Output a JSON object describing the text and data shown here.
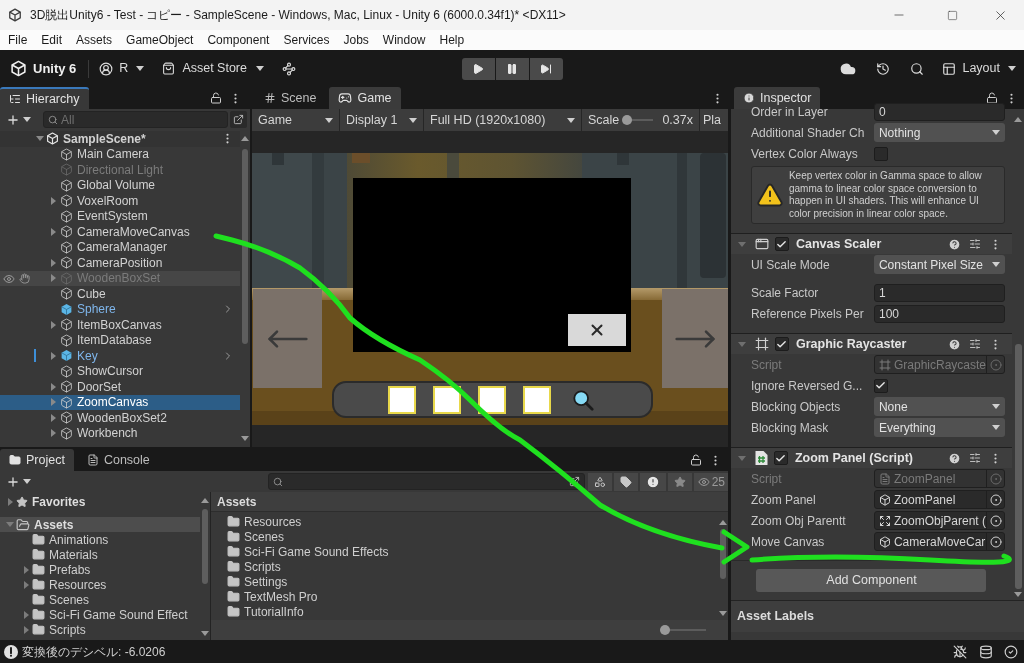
{
  "window": {
    "title": "3D脱出Unity6 - Test - コピー - SampleScene - Windows, Mac, Linux - Unity 6 (6000.0.34f1)* <DX11>"
  },
  "menu": [
    "File",
    "Edit",
    "Assets",
    "GameObject",
    "Component",
    "Services",
    "Jobs",
    "Window",
    "Help"
  ],
  "toolbar": {
    "product": "Unity 6",
    "account": "R",
    "asset_store": "Asset Store",
    "playback": [
      {
        "kind": "play"
      },
      {
        "kind": "pause"
      },
      {
        "kind": "step"
      }
    ],
    "layout": "Layout"
  },
  "hierarchy": {
    "tab": {
      "label": "Hierarchy",
      "selected": true,
      "focused": true
    },
    "search": {
      "placeholder": "All"
    },
    "tree": [
      {
        "name": "SampleScene*",
        "kind": "scene",
        "has_children": true,
        "expanded": true,
        "disabled": false,
        "selected": false,
        "hovered": false,
        "overridden": false,
        "children": [
          {
            "name": "Main Camera",
            "kind": "object",
            "has_children": false,
            "expanded": false,
            "disabled": false,
            "selected": false,
            "hovered": false,
            "overridden": false
          },
          {
            "name": "Directional Light",
            "kind": "object",
            "has_children": false,
            "expanded": false,
            "disabled": true,
            "selected": false,
            "hovered": false,
            "overridden": false
          },
          {
            "name": "Global Volume",
            "kind": "object",
            "has_children": false,
            "expanded": false,
            "disabled": false,
            "selected": false,
            "hovered": false,
            "overridden": false
          },
          {
            "name": "VoxelRoom",
            "kind": "object",
            "has_children": true,
            "expanded": false,
            "disabled": false,
            "selected": false,
            "hovered": false,
            "overridden": false
          },
          {
            "name": "EventSystem",
            "kind": "object",
            "has_children": false,
            "expanded": false,
            "disabled": false,
            "selected": false,
            "hovered": false,
            "overridden": false
          },
          {
            "name": "CameraMoveCanvas",
            "kind": "object",
            "has_children": true,
            "expanded": false,
            "disabled": false,
            "selected": false,
            "hovered": false,
            "overridden": false
          },
          {
            "name": "CameraManager",
            "kind": "object",
            "has_children": false,
            "expanded": false,
            "disabled": false,
            "selected": false,
            "hovered": false,
            "overridden": false
          },
          {
            "name": "CameraPosition",
            "kind": "object",
            "has_children": true,
            "expanded": false,
            "disabled": false,
            "selected": false,
            "hovered": false,
            "overridden": false
          },
          {
            "name": "WoodenBoxSet",
            "kind": "object",
            "has_children": true,
            "expanded": false,
            "disabled": true,
            "selected": false,
            "hovered": true,
            "overridden": false
          },
          {
            "name": "Cube",
            "kind": "object",
            "has_children": false,
            "expanded": false,
            "disabled": false,
            "selected": false,
            "hovered": false,
            "overridden": false
          },
          {
            "name": "Sphere",
            "kind": "prefab",
            "has_children": false,
            "expanded": false,
            "disabled": false,
            "selected": false,
            "hovered": false,
            "overridden": false
          },
          {
            "name": "ItemBoxCanvas",
            "kind": "object",
            "has_children": true,
            "expanded": false,
            "disabled": false,
            "selected": false,
            "hovered": false,
            "overridden": false
          },
          {
            "name": "ItemDatabase",
            "kind": "object",
            "has_children": false,
            "expanded": false,
            "disabled": false,
            "selected": false,
            "hovered": false,
            "overridden": false
          },
          {
            "name": "Key",
            "kind": "prefab",
            "has_children": true,
            "expanded": false,
            "disabled": false,
            "selected": false,
            "hovered": false,
            "overridden": true
          },
          {
            "name": "ShowCursor",
            "kind": "object",
            "has_children": false,
            "expanded": false,
            "disabled": false,
            "selected": false,
            "hovered": false,
            "overridden": false
          },
          {
            "name": "DoorSet",
            "kind": "object",
            "has_children": true,
            "expanded": false,
            "disabled": false,
            "selected": false,
            "hovered": false,
            "overridden": false
          },
          {
            "name": "ZoomCanvas",
            "kind": "object",
            "has_children": true,
            "expanded": false,
            "disabled": false,
            "selected": true,
            "hovered": false,
            "overridden": false
          },
          {
            "name": "WoodenBoxSet2",
            "kind": "object",
            "has_children": true,
            "expanded": false,
            "disabled": false,
            "selected": false,
            "hovered": false,
            "overridden": false
          },
          {
            "name": "Workbench",
            "kind": "object",
            "has_children": true,
            "expanded": false,
            "disabled": false,
            "selected": false,
            "hovered": false,
            "overridden": false
          }
        ]
      }
    ]
  },
  "game": {
    "tabs": [
      {
        "label": "Scene",
        "kind": "scene",
        "selected": false,
        "focused": false
      },
      {
        "label": "Game",
        "kind": "game",
        "selected": true,
        "focused": false
      }
    ],
    "controls": [
      {
        "kind": "dropdown",
        "value": "Game"
      },
      {
        "kind": "dropdown",
        "value": "Display 1"
      },
      {
        "kind": "dropdown",
        "value": "Full HD (1920x1080)"
      },
      {
        "kind": "slider",
        "label": "Scale",
        "level": 0.05,
        "reading": "0.37x"
      },
      {
        "kind": "text",
        "value": "Pla"
      }
    ],
    "view": {
      "item_slots": [
        {
          "empty": true
        },
        {
          "empty": true
        },
        {
          "empty": true
        },
        {
          "empty": true
        }
      ]
    }
  },
  "inspector": {
    "tab": {
      "label": "Inspector",
      "selected": true,
      "focused": false
    },
    "fields": [
      {
        "kind": "int",
        "label": "Order in Layer",
        "value": "0",
        "disabled": false
      },
      {
        "kind": "dropdown",
        "label": "Additional Shader Ch",
        "value": "Nothing",
        "disabled": false
      },
      {
        "kind": "checkbox",
        "label": "Vertex Color Always",
        "checked": false,
        "disabled": false
      },
      {
        "kind": "help",
        "text": "Keep vertex color in Gamma space to allow gamma to linear color space conversion to happen in UI shaders. This will enhance UI color precision in linear color space."
      }
    ],
    "components": [
      {
        "kind": "canvas_scaler",
        "title": "Canvas Scaler",
        "enabled": true,
        "expanded": true,
        "fields": [
          {
            "kind": "dropdown",
            "label": "UI Scale Mode",
            "value": "Constant Pixel Size",
            "disabled": false
          },
          {
            "kind": "float",
            "label": "Scale Factor",
            "value": "1",
            "disabled": false
          },
          {
            "kind": "float",
            "label": "Reference Pixels Per",
            "value": "100",
            "disabled": false
          }
        ]
      },
      {
        "kind": "raycaster",
        "title": "Graphic Raycaster",
        "enabled": true,
        "expanded": true,
        "fields": [
          {
            "kind": "raycaster",
            "label": "Script",
            "value": "GraphicRaycaste",
            "disabled": true
          },
          {
            "kind": "checkbox",
            "label": "Ignore Reversed G...",
            "checked": true,
            "disabled": false
          },
          {
            "kind": "dropdown",
            "label": "Blocking Objects",
            "value": "None",
            "disabled": false
          },
          {
            "kind": "dropdown",
            "label": "Blocking Mask",
            "value": "Everything",
            "disabled": false
          }
        ]
      },
      {
        "kind": "script",
        "title": "Zoom Panel (Script)",
        "enabled": true,
        "expanded": true,
        "fields": [
          {
            "kind": "script",
            "label": "Script",
            "value": "ZoomPanel",
            "disabled": true
          },
          {
            "kind": "gameobject",
            "label": "Zoom Panel",
            "value": "ZoomPanel",
            "disabled": false
          },
          {
            "kind": "transform",
            "label": "Zoom Obj Parentt",
            "value": "ZoomObjParent (",
            "disabled": false
          },
          {
            "kind": "gameobject",
            "label": "Move Canvas",
            "value": "CameraMoveCar",
            "disabled": false
          }
        ]
      }
    ],
    "add_component": "Add Component",
    "asset_labels": "Asset Labels"
  },
  "project": {
    "tabs": [
      {
        "label": "Project",
        "kind": "project",
        "selected": true,
        "focused": false
      },
      {
        "label": "Console",
        "kind": "console",
        "selected": false,
        "focused": false
      }
    ],
    "filter_count": "25",
    "tree": [
      {
        "label": "Favorites",
        "kind": "favorites",
        "has_children": true,
        "expanded": false,
        "selected": false
      },
      {
        "label": "Assets",
        "kind": "folder",
        "has_children": true,
        "expanded": true,
        "selected": true,
        "children": [
          {
            "label": "Animations",
            "kind": "folder",
            "has_children": false,
            "expanded": false,
            "selected": false
          },
          {
            "label": "Materials",
            "kind": "folder",
            "has_children": false,
            "expanded": false,
            "selected": false
          },
          {
            "label": "Prefabs",
            "kind": "folder",
            "has_children": true,
            "expanded": false,
            "selected": false
          },
          {
            "label": "Resources",
            "kind": "folder",
            "has_children": true,
            "expanded": false,
            "selected": false
          },
          {
            "label": "Scenes",
            "kind": "folder",
            "has_children": false,
            "expanded": false,
            "selected": false
          },
          {
            "label": "Sci-Fi Game Sound Effect",
            "kind": "folder",
            "has_children": true,
            "expanded": false,
            "selected": false
          },
          {
            "label": "Scripts",
            "kind": "folder",
            "has_children": true,
            "expanded": false,
            "selected": false
          }
        ]
      }
    ],
    "folder": "Assets",
    "items": [
      "Resources",
      "Scenes",
      "Sci-Fi Game Sound Effects",
      "Scripts",
      "Settings",
      "TextMesh Pro",
      "TutorialInfo"
    ],
    "icon_size": {
      "level": 0
    }
  },
  "status_bar": {
    "message": "変換後のデシベル: -6.0206"
  }
}
